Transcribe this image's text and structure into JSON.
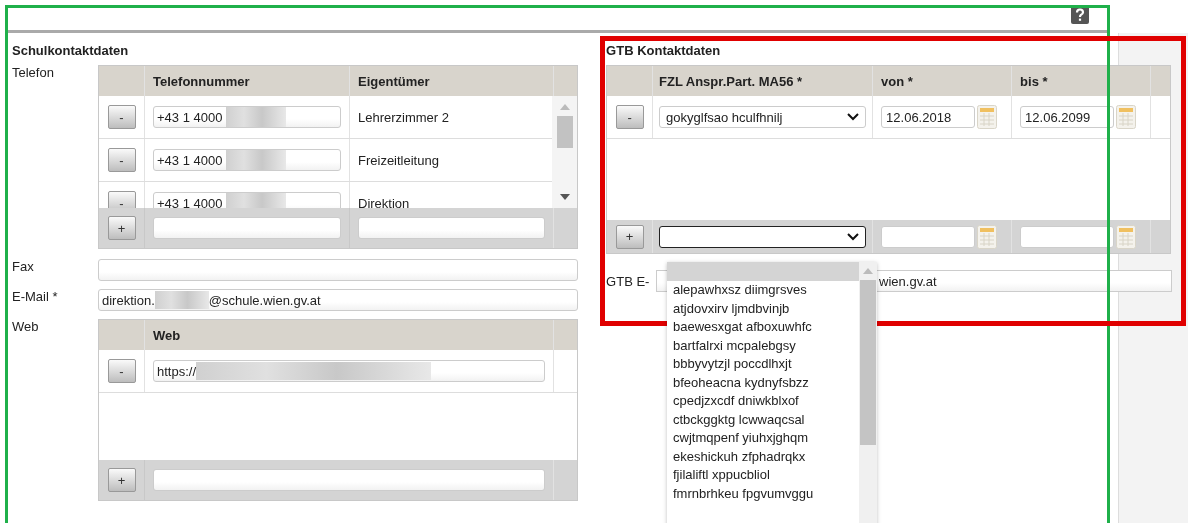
{
  "school_contact": {
    "title": "Schulkontaktdaten",
    "phone": {
      "label": "Telefon",
      "columns": [
        "Telefonnummer",
        "Eigentümer"
      ],
      "rows": [
        {
          "remove_button": "-",
          "number": "+43 1 4000",
          "owner": "Lehrerzimmer 2"
        },
        {
          "remove_button": "-",
          "number": "+43 1 4000",
          "owner": "Freizeitleitung"
        },
        {
          "remove_button": "-",
          "number": "+43 1 4000",
          "owner": "Direktion"
        }
      ],
      "add_button": "+"
    },
    "fax": {
      "label": "Fax"
    },
    "email": {
      "label": "E-Mail *",
      "value_start": "direktion.",
      "value_end": "@schule.wien.gv.at"
    },
    "web": {
      "label": "Web",
      "columns": [
        "Web"
      ],
      "rows": [
        {
          "remove_button": "-",
          "value": "https://"
        }
      ],
      "add_button": "+"
    }
  },
  "gtb_contact": {
    "title": "GTB Kontaktdaten",
    "columns": [
      "FZL Anspr.Part. MA56 *",
      "von *",
      "bis *"
    ],
    "rows": [
      {
        "remove_button": "-",
        "person": "gokyglfsao hculfhnilj",
        "from": "12.06.2018",
        "to": "12.06.2099"
      }
    ],
    "add_button": "+",
    "email": {
      "label": "GTB E-",
      "value": "wien.gv.at"
    }
  },
  "dropdown": {
    "open": true,
    "blank_option_highlighted": true,
    "options": [
      {
        "label": "alepawhxsz diimgrsves",
        "selected": false
      },
      {
        "label": "atjdovxirv ljmdbvinjb",
        "selected": false
      },
      {
        "label": "baewesxgat afboxuwhfc",
        "selected": false
      },
      {
        "label": "bartfalrxi mcpalebgsy",
        "selected": false
      },
      {
        "label": "bbbyvytzjl poccdlhxjt",
        "selected": false
      },
      {
        "label": "bfeoheacna kydnyfsbzz",
        "selected": false
      },
      {
        "label": "cpedjzxcdf dniwkblxof",
        "selected": false
      },
      {
        "label": "ctbckggktg lcwwaqcsal",
        "selected": false
      },
      {
        "label": "cwjtmqpenf yiuhxjghqm",
        "selected": false
      },
      {
        "label": "ekeshickuh zfphadrqkx",
        "selected": false
      },
      {
        "label": "fjilaliftl xppucbliol",
        "selected": false
      },
      {
        "label": "fmrnbrhkeu fpgvumvggu",
        "selected": false
      }
    ]
  },
  "annotations": [
    {
      "kind": "frame",
      "color": "#1fb04a"
    },
    {
      "kind": "highlight",
      "color": "#e00000"
    }
  ]
}
